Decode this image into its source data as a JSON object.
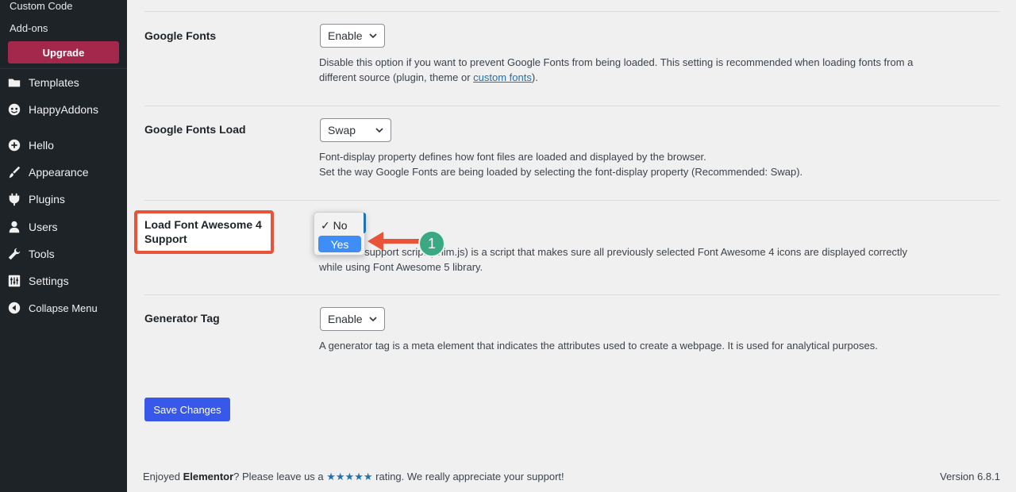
{
  "sidebar": {
    "sub_items": [
      "Custom Code",
      "Add-ons"
    ],
    "upgrade_label": "Upgrade",
    "menu": [
      {
        "label": "Templates",
        "icon": "folder-icon"
      },
      {
        "label": "HappyAddons",
        "icon": "happyaddons-icon"
      },
      {
        "label": "Hello",
        "icon": "plus-circle-icon"
      },
      {
        "label": "Appearance",
        "icon": "paintbrush-icon"
      },
      {
        "label": "Plugins",
        "icon": "plug-icon"
      },
      {
        "label": "Users",
        "icon": "user-icon"
      },
      {
        "label": "Tools",
        "icon": "wrench-icon"
      },
      {
        "label": "Settings",
        "icon": "sliders-icon"
      },
      {
        "label": "Collapse Menu",
        "icon": "collapse-arrow-icon"
      }
    ]
  },
  "settings": {
    "google_fonts": {
      "label": "Google Fonts",
      "value": "Enable",
      "desc_before_link": "Disable this option if you want to prevent Google Fonts from being loaded. This setting is recommended when loading fonts from a",
      "desc_line2_before": "different source (plugin, theme or ",
      "desc_link": "custom fonts",
      "desc_after_link": ")."
    },
    "google_fonts_load": {
      "label": "Google Fonts Load",
      "value": "Swap",
      "desc_line1": "Font-display property defines how font files are loaded and displayed by the browser.",
      "desc_line2": "Set the way Google Fonts are being loaded by selecting the font-display property (Recommended: Swap)."
    },
    "font_awesome": {
      "label_line1": "Load Font Awesome 4",
      "label_line2": "Support",
      "option_no": "✓ No",
      "option_yes": "Yes",
      "desc_line1": "...some 4 support script (shim.js) is a script that makes sure all previously selected Font Awesome 4 icons are displayed correctly",
      "desc_line2": "while using Font Awesome 5 library."
    },
    "generator_tag": {
      "label": "Generator Tag",
      "value": "Enable",
      "desc": "A generator tag is a meta element that indicates the attributes used to create a webpage. It is used for analytical purposes."
    }
  },
  "annotation": {
    "step": "1",
    "highlight_color": "#e8533a",
    "badge_color": "#3aa882"
  },
  "save_label": "Save Changes",
  "footer": {
    "text_before": "Enjoyed ",
    "brand": "Elementor",
    "text_middle": "? Please leave us a ",
    "stars": "★★★★★",
    "text_after": " rating. We really appreciate your support!",
    "version": "Version 6.8.1"
  },
  "colors": {
    "sidebar_bg": "#1d2327",
    "upgrade_bg": "#a4284b",
    "primary_button": "#3858e9",
    "dropdown_selected": "#3f8ef7"
  }
}
